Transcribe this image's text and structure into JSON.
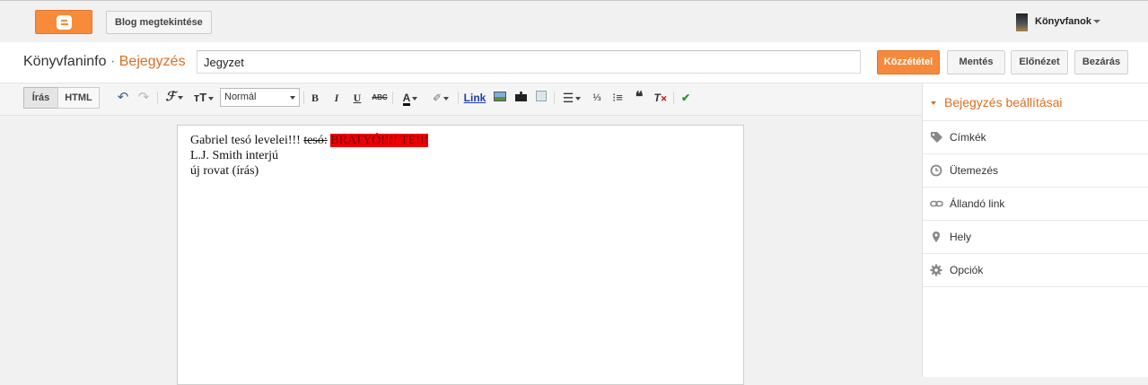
{
  "header": {
    "view_blog": "Blog megtekintése",
    "account_name": "Könyvfanok"
  },
  "post": {
    "blog_name": "Könyvfaninfo",
    "separator": "·",
    "section": "Bejegyzés",
    "title_value": "Jegyzet",
    "buttons": {
      "publish": "Közzététel",
      "save": "Mentés",
      "preview": "Előnézet",
      "close": "Bezárás"
    }
  },
  "toolbar": {
    "mode_compose": "Írás",
    "mode_html": "HTML",
    "format_value": "Normál",
    "link_label": "Link"
  },
  "editor": {
    "line1_normal": "Gabriel tesó levelei!!! ",
    "line1_strike": "tesó:",
    "line1_highlight": "BRATYÓ!!!! TE!!!",
    "line2": "L.J. Smith interjú",
    "line3": "új rovat (írás)"
  },
  "sidebar": {
    "header": "Bejegyzés beállításai",
    "items": [
      {
        "label": "Címkék",
        "icon": "tag-icon"
      },
      {
        "label": "Ütemezés",
        "icon": "clock-icon"
      },
      {
        "label": "Állandó link",
        "icon": "link-icon"
      },
      {
        "label": "Hely",
        "icon": "location-pin-icon"
      },
      {
        "label": "Opciók",
        "icon": "gear-icon"
      }
    ]
  },
  "colors": {
    "accent": "#dd6d21",
    "publish_button": "#f58a3c",
    "highlight": "#ee0000"
  }
}
